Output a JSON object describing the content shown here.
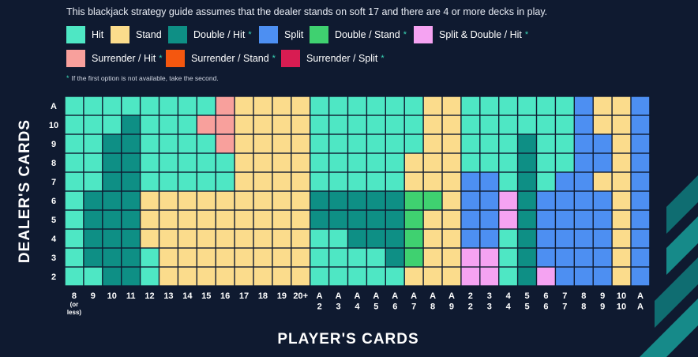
{
  "intro": "This blackjack strategy guide assumes that the dealer stands on soft 17 and there are 4 or more decks in play.",
  "legend": [
    {
      "key": "H",
      "label": "Hit",
      "star": false,
      "color": "#4ee7c4"
    },
    {
      "key": "S",
      "label": "Stand",
      "star": false,
      "color": "#fbdc8c"
    },
    {
      "key": "DH",
      "label": "Double / Hit",
      "star": true,
      "color": "#0e8f85"
    },
    {
      "key": "P",
      "label": "Split",
      "star": false,
      "color": "#4d8ff2"
    },
    {
      "key": "DS",
      "label": "Double / Stand",
      "star": true,
      "color": "#3fd170"
    },
    {
      "key": "PD",
      "label": "Split & Double / Hit",
      "star": true,
      "color": "#f5a3f2"
    },
    {
      "key": "RH",
      "label": "Surrender / Hit",
      "star": true,
      "color": "#f8a09c"
    },
    {
      "key": "RS",
      "label": "Surrender / Stand",
      "star": true,
      "color": "#f4570f"
    },
    {
      "key": "RP",
      "label": "Surrender / Split",
      "star": true,
      "color": "#d81c52"
    }
  ],
  "star_symbol": "*",
  "footnote": "If the first option is not available, take the second.",
  "axis": {
    "y_title": "DEALER'S CARDS",
    "x_title": "PLAYER'S CARDS"
  },
  "chart_data": {
    "type": "table",
    "rows": [
      "A",
      "10",
      "9",
      "8",
      "7",
      "6",
      "5",
      "4",
      "3",
      "2"
    ],
    "columns": [
      [
        "8",
        "(or",
        "less)"
      ],
      [
        "9"
      ],
      [
        "10"
      ],
      [
        "11"
      ],
      [
        "12"
      ],
      [
        "13"
      ],
      [
        "14"
      ],
      [
        "15"
      ],
      [
        "16"
      ],
      [
        "17"
      ],
      [
        "18"
      ],
      [
        "19"
      ],
      [
        "20+"
      ],
      [
        "A",
        "2"
      ],
      [
        "A",
        "3"
      ],
      [
        "A",
        "4"
      ],
      [
        "A",
        "5"
      ],
      [
        "A",
        "6"
      ],
      [
        "A",
        "7"
      ],
      [
        "A",
        "8"
      ],
      [
        "A",
        "9"
      ],
      [
        "2",
        "2"
      ],
      [
        "3",
        "3"
      ],
      [
        "4",
        "4"
      ],
      [
        "5",
        "5"
      ],
      [
        "6",
        "6"
      ],
      [
        "7",
        "7"
      ],
      [
        "8",
        "8"
      ],
      [
        "9",
        "9"
      ],
      [
        "10",
        "10"
      ],
      [
        "A",
        "A"
      ]
    ],
    "cells": [
      [
        "H",
        "H",
        "H",
        "H",
        "H",
        "H",
        "H",
        "H",
        "RH",
        "S",
        "S",
        "S",
        "S",
        "H",
        "H",
        "H",
        "H",
        "H",
        "H",
        "S",
        "S",
        "H",
        "H",
        "H",
        "H",
        "H",
        "H",
        "P",
        "S",
        "S",
        "P"
      ],
      [
        "H",
        "H",
        "H",
        "DH",
        "H",
        "H",
        "H",
        "RH",
        "RH",
        "S",
        "S",
        "S",
        "S",
        "H",
        "H",
        "H",
        "H",
        "H",
        "H",
        "S",
        "S",
        "H",
        "H",
        "H",
        "H",
        "H",
        "H",
        "P",
        "S",
        "S",
        "P"
      ],
      [
        "H",
        "H",
        "DH",
        "DH",
        "H",
        "H",
        "H",
        "H",
        "RH",
        "S",
        "S",
        "S",
        "S",
        "H",
        "H",
        "H",
        "H",
        "H",
        "H",
        "S",
        "S",
        "H",
        "H",
        "H",
        "DH",
        "H",
        "H",
        "P",
        "P",
        "S",
        "P"
      ],
      [
        "H",
        "H",
        "DH",
        "DH",
        "H",
        "H",
        "H",
        "H",
        "H",
        "S",
        "S",
        "S",
        "S",
        "H",
        "H",
        "H",
        "H",
        "H",
        "S",
        "S",
        "S",
        "H",
        "H",
        "H",
        "DH",
        "H",
        "H",
        "P",
        "P",
        "S",
        "P"
      ],
      [
        "H",
        "H",
        "DH",
        "DH",
        "H",
        "H",
        "H",
        "H",
        "H",
        "S",
        "S",
        "S",
        "S",
        "H",
        "H",
        "H",
        "H",
        "H",
        "S",
        "S",
        "S",
        "P",
        "P",
        "H",
        "DH",
        "H",
        "P",
        "P",
        "S",
        "S",
        "P"
      ],
      [
        "H",
        "DH",
        "DH",
        "DH",
        "S",
        "S",
        "S",
        "S",
        "S",
        "S",
        "S",
        "S",
        "S",
        "DH",
        "DH",
        "DH",
        "DH",
        "DH",
        "DS",
        "DS",
        "S",
        "P",
        "P",
        "PD",
        "DH",
        "P",
        "P",
        "P",
        "P",
        "S",
        "P"
      ],
      [
        "H",
        "DH",
        "DH",
        "DH",
        "S",
        "S",
        "S",
        "S",
        "S",
        "S",
        "S",
        "S",
        "S",
        "DH",
        "DH",
        "DH",
        "DH",
        "DH",
        "DS",
        "S",
        "S",
        "P",
        "P",
        "PD",
        "DH",
        "P",
        "P",
        "P",
        "P",
        "S",
        "P"
      ],
      [
        "H",
        "DH",
        "DH",
        "DH",
        "S",
        "S",
        "S",
        "S",
        "S",
        "S",
        "S",
        "S",
        "S",
        "H",
        "H",
        "DH",
        "DH",
        "DH",
        "DS",
        "S",
        "S",
        "P",
        "P",
        "H",
        "DH",
        "P",
        "P",
        "P",
        "P",
        "S",
        "P"
      ],
      [
        "H",
        "DH",
        "DH",
        "DH",
        "H",
        "S",
        "S",
        "S",
        "S",
        "S",
        "S",
        "S",
        "S",
        "H",
        "H",
        "H",
        "H",
        "DH",
        "DS",
        "S",
        "S",
        "PD",
        "PD",
        "H",
        "DH",
        "P",
        "P",
        "P",
        "P",
        "S",
        "P"
      ],
      [
        "H",
        "H",
        "DH",
        "DH",
        "H",
        "S",
        "S",
        "S",
        "S",
        "S",
        "S",
        "S",
        "S",
        "H",
        "H",
        "H",
        "H",
        "H",
        "S",
        "S",
        "S",
        "PD",
        "PD",
        "H",
        "DH",
        "PD",
        "P",
        "P",
        "P",
        "S",
        "P"
      ]
    ]
  }
}
